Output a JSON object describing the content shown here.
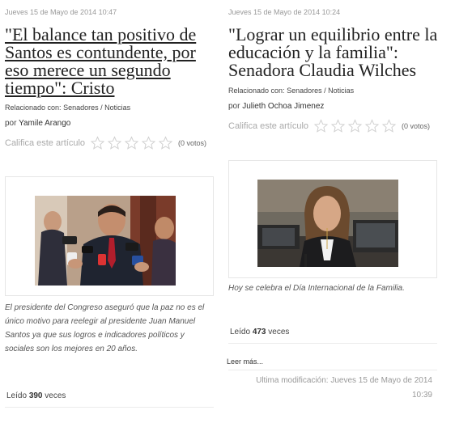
{
  "left_article": {
    "date": "Jueves 15 de Mayo de 2014 10:47",
    "title": "\"El balance tan positivo de Santos es contundente, por eso merece un segundo tiempo\": Cristo",
    "related_prefix": "Relacionado con:",
    "related_links": "Senadores / Noticias",
    "byline_prefix": "por",
    "author": "Yamile Arango",
    "rate_label": "Califica este artículo",
    "votes": "(0 votos)",
    "caption": "El presidente del Congreso aseguró que la paz no es el único motivo para reelegir al presidente Juan Manuel Santos ya que sus logros e indicadores políticos y sociales son los mejores en 20 años.",
    "reads_prefix": "Leído",
    "reads_count": "390",
    "reads_suffix": "veces"
  },
  "right_article": {
    "date": "Jueves 15 de Mayo de 2014 10:24",
    "title": "\"Lograr un equilibrio entre la educación y la familia\": Senadora Claudia Wilches",
    "related_prefix": "Relacionado con:",
    "related_links": "Senadores / Noticias",
    "byline_prefix": "por",
    "author": "Julieth Ochoa Jimenez",
    "rate_label": "Califica este artículo",
    "votes": "(0 votos)",
    "caption": "Hoy se celebra el Día Internacional de la Familia.",
    "reads_prefix": "Leído",
    "reads_count": "473",
    "reads_suffix": "veces",
    "read_more": "Leer más...",
    "modified_line1": "Ultima modificación: Jueves 15 de Mayo de 2014",
    "modified_line2": "10:39"
  },
  "colors": {
    "star_outline": "#cfcfcf",
    "meta_gray": "#999999",
    "border": "#e6e6e6"
  },
  "icons": {
    "rating": "star-icon"
  }
}
